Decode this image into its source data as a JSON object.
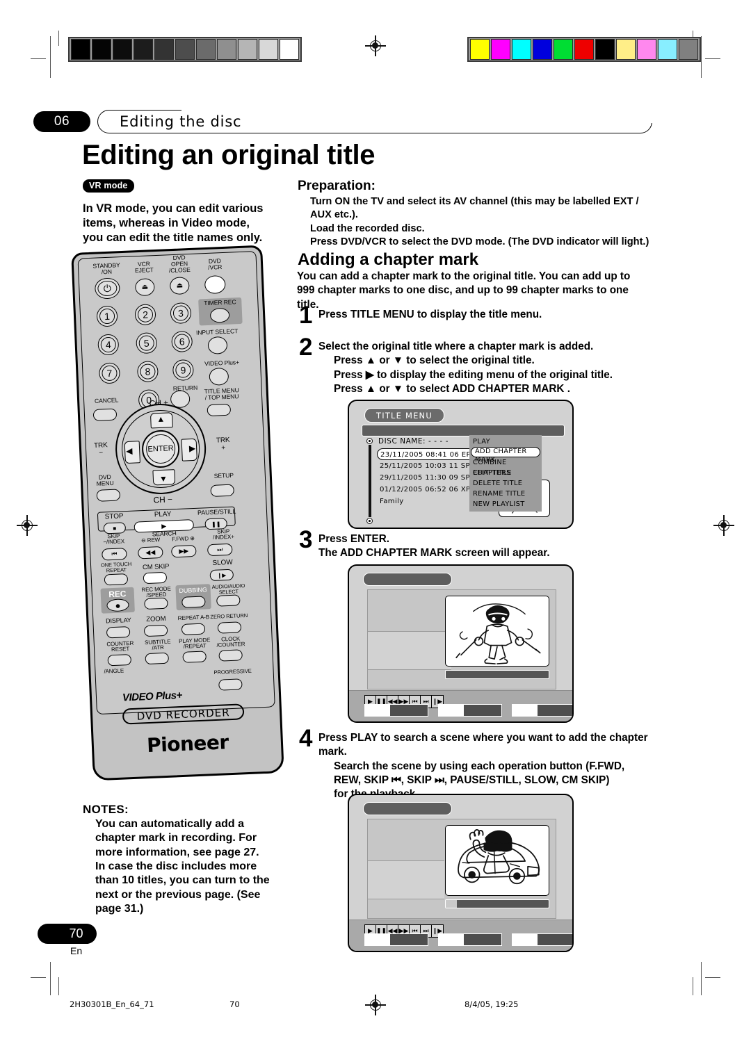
{
  "header": {
    "chapter_number": "06",
    "chapter_title": "Editing the disc",
    "page_title": "Editing an original title"
  },
  "left": {
    "mode_badge": "VR mode",
    "intro": "In VR mode, you can edit various items, whereas in Video mode, you can edit the title names only.",
    "notes_label": "NOTES:",
    "notes_text": "You can automatically add a chapter mark in recording. For more information, see page 27. In case the disc includes more than 10 titles, you can turn to the next or the previous page. (See page 31.)",
    "page_number": "70",
    "page_lang": "En"
  },
  "right": {
    "preparation_label": "Preparation:",
    "preparation_text": "Turn ON the TV and select its AV channel (this may be labelled EXT / AUX etc.).\nLoad the recorded disc.\nPress DVD/VCR to select the DVD mode. (The DVD indicator will light.)",
    "section_heading": "Adding a chapter mark",
    "section_intro": "You can add a chapter mark to the original title. You can add up to 999 chapter marks to one disc, and up to 99 chapter marks to one title.",
    "steps": [
      {
        "number": "1",
        "main": "Press TITLE MENU to display the title menu.",
        "subs": []
      },
      {
        "number": "2",
        "main": "Select the original title where a chapter mark is added.",
        "subs": [
          "Press ▲ or ▼ to select the original title.",
          "Press ▶ to display the editing menu of the original title.",
          "Press ▲ or ▼ to select  ADD CHAPTER MARK ."
        ]
      },
      {
        "number": "3",
        "main": "Press ENTER.",
        "subs": [
          "The ADD CHAPTER MARK screen will appear."
        ]
      },
      {
        "number": "4",
        "main": "Press PLAY to search a scene where you want to add the chapter mark.",
        "subs": [
          "Search the scene by using each operation button (F.FWD,",
          "REW, SKIP ⏮, SKIP ⏭, PAUSE/STILL, SLOW, CM SKIP)",
          "for the playback."
        ]
      }
    ]
  },
  "title_menu_screen": {
    "pill_label": "TITLE MENU",
    "disc_name_label": "DISC NAME: - - - -",
    "titles": [
      "23/11/2005 08:41 06 EP",
      "25/11/2005 10:03 11 SP",
      "29/11/2005 11:30 09 SP",
      "01/12/2005 06:52 06 XP",
      "Family"
    ],
    "selected_title_index": 0,
    "right_fragments": [
      "005",
      "7"
    ],
    "menu_items": [
      "PLAY",
      "ADD CHAPTER MARK",
      "COMBINE CHAPTERS",
      "EDIT TITLE",
      "DELETE TITLE",
      "RENAME TITLE",
      "NEW PLAYLIST"
    ],
    "selected_menu_index": 1
  },
  "player_screen_1": {
    "transport_icons": [
      "▶",
      "❙❙",
      "◀◀",
      "▶▶",
      "⏮",
      "⏭",
      "▶❙"
    ],
    "progress_percent": 0,
    "slot_fill_percent": 38,
    "video_caption": "skier-illustration"
  },
  "player_screen_2": {
    "transport_icons": [
      "▶",
      "❙❙",
      "◀◀",
      "▶▶",
      "⏮",
      "⏭",
      "▶❙"
    ],
    "progress_percent": 8,
    "slot_fill_percent": 38,
    "video_caption": "car-driver-illustration"
  },
  "remote": {
    "top_labels": [
      "STANDBY\n/ON",
      "VCR\nEJECT",
      "DVD\nOPEN\n/CLOSE",
      "DVD\n/VCR"
    ],
    "timer_rec": "TIMER REC",
    "input_select": "INPUT SELECT",
    "video_plus": "VIDEO Plus+",
    "return_label": "RETURN",
    "cancel_label": "CANCEL",
    "title_menu_label": "TITLE MENU\n/ TOP MENU",
    "ch_plus": "CH +",
    "ch_minus": "CH −",
    "trk_minus": "TRK\n−",
    "trk_plus": "TRK\n+",
    "dvd_menu": "DVD\nMENU",
    "setup": "SETUP",
    "enter": "ENTER",
    "numbers": [
      "1",
      "2",
      "3",
      "4",
      "5",
      "6",
      "7",
      "8",
      "9",
      "0"
    ],
    "transport_labels": [
      "STOP",
      "PLAY",
      "PAUSE/STILL"
    ],
    "skip_index_minus": "SKIP\n−/INDEX",
    "search_label": "SEARCH",
    "rew_label": "⊖ REW",
    "ffwd_label": "F.FWD ⊕",
    "skip_index_plus": "SKIP\n/INDEX+",
    "one_touch_repeat": "ONE TOUCH\nREPEAT",
    "cm_skip": "CM SKIP",
    "slow": "SLOW",
    "rec": "REC",
    "rec_mode_speed": "REC MODE\n/SPEED",
    "dubbing": "DUBBING",
    "audio_select": "AUDIO/AUDIO\nSELECT",
    "display": "DISPLAY",
    "zoom": "ZOOM",
    "repeat_ab": "REPEAT A-B",
    "zero_return": "ZERO RETURN",
    "counter_reset": "COUNTER\nRESET",
    "subtitle_atr": "SUBTITLE\n/ATR",
    "play_mode_repeat": "PLAY MODE\n/REPEAT",
    "clock_counter": "CLOCK\n/COUNTER",
    "angle": "/ANGLE",
    "progressive": "PROGRESSIVE",
    "video_plus_logo": "VIDEO Plus+",
    "dvd_recorder": "DVD RECORDER",
    "brand": "Pioneer"
  },
  "calibration": {
    "gray_swatches": [
      "#000000",
      "#050505",
      "#0d0d0d",
      "#1c1c1c",
      "#333333",
      "#4d4d4d",
      "#6b6b6b",
      "#8f8f8f",
      "#b5b5b5",
      "#d8d8d8",
      "#ffffff"
    ],
    "color_swatches": [
      "#ffff00",
      "#ff00ff",
      "#00ffff",
      "#0000dd",
      "#00dd33",
      "#ee0000",
      "#000000",
      "#ffee88",
      "#ff88ee",
      "#88eeff",
      "#808080"
    ]
  },
  "footer": {
    "file_code": "2H30301B_En_64_71",
    "page": "70",
    "date": "8/4/05, 19:25"
  }
}
